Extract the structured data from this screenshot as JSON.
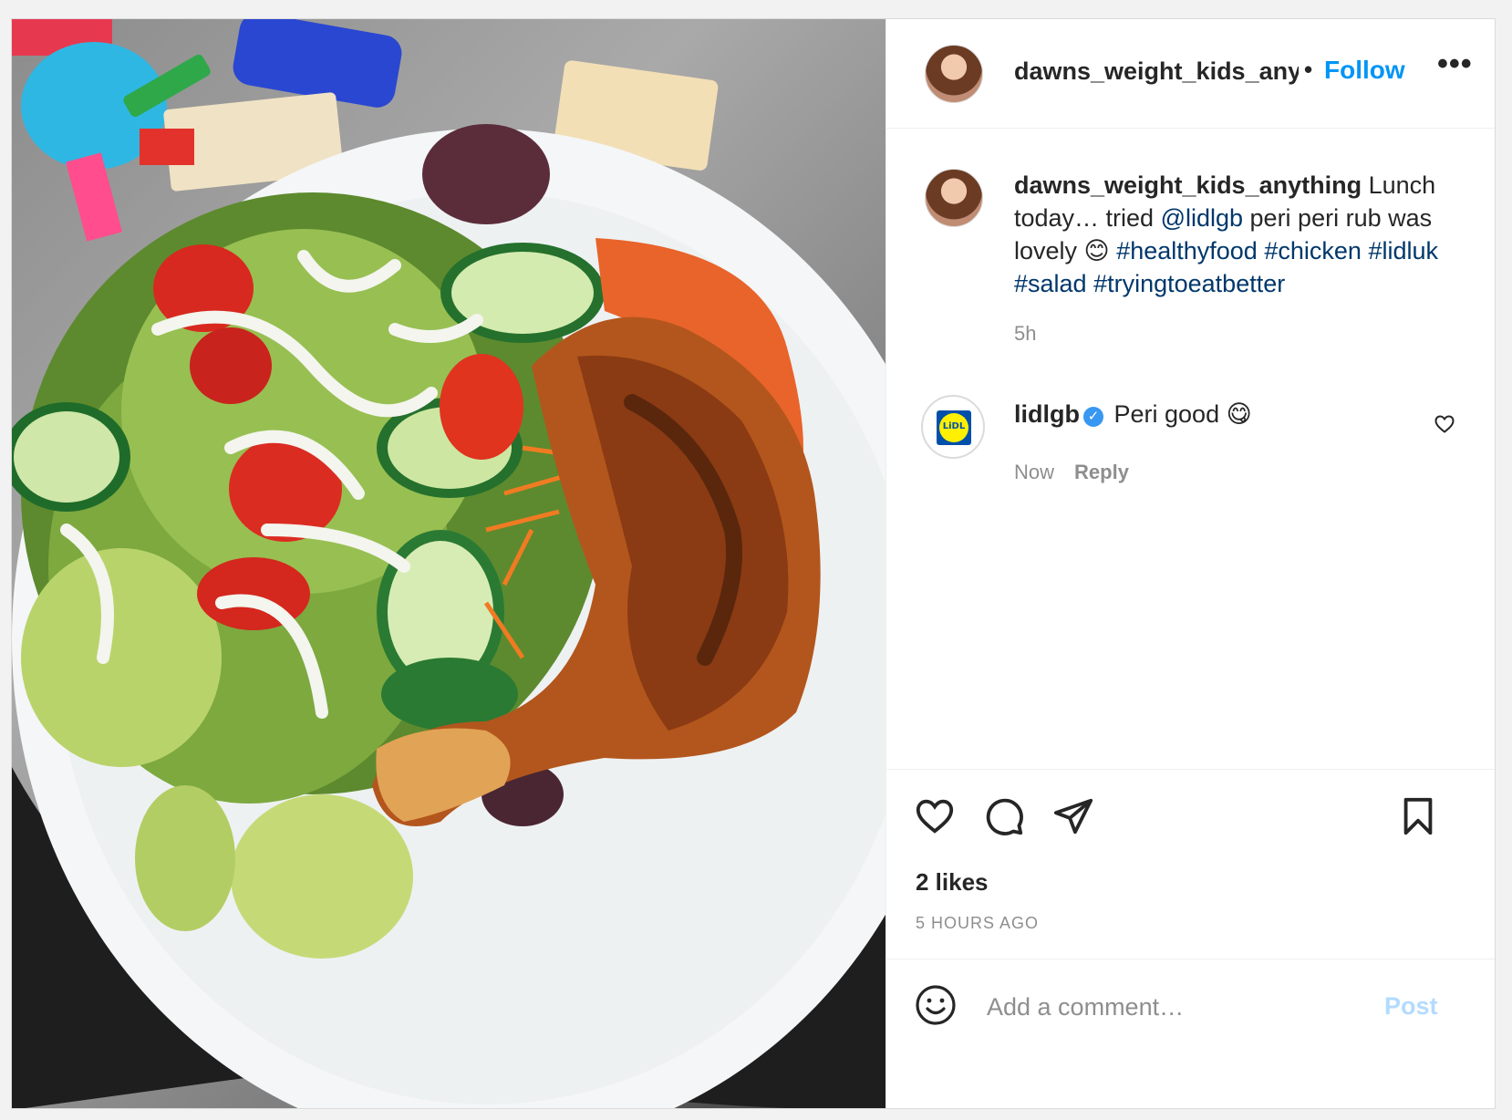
{
  "header": {
    "username": "dawns_weight_kids_anything",
    "separator": "•",
    "follow_label": "Follow",
    "more_label": "•••"
  },
  "caption": {
    "username": "dawns_weight_kids_anything",
    "text_part1": " Lunch today… tried ",
    "mention": "@lidlgb",
    "text_part2": " peri peri rub was lovely 😊 ",
    "hashtags": [
      "#healthyfood",
      "#chicken",
      "#lidluk",
      "#salad",
      "#tryingtoeatbetter"
    ],
    "time": "5h"
  },
  "comment": {
    "username": "lidlgb",
    "verified_mark": "✓",
    "logo_text": "LiDL",
    "text": "Peri good 😋",
    "time": "Now",
    "reply_label": "Reply"
  },
  "actions": {
    "likes": "2 likes",
    "time_ago": "5 HOURS AGO"
  },
  "add_comment": {
    "placeholder": "Add a comment…",
    "post_label": "Post"
  },
  "icons": {
    "like": "heart-icon",
    "comment": "comment-bubble-icon",
    "share": "paper-plane-icon",
    "save": "bookmark-icon",
    "emoji": "emoji-icon"
  },
  "colors": {
    "accent": "#0095f6",
    "link": "#00376b",
    "muted": "#8e8e8e",
    "post_disabled": "#b3dbff"
  }
}
